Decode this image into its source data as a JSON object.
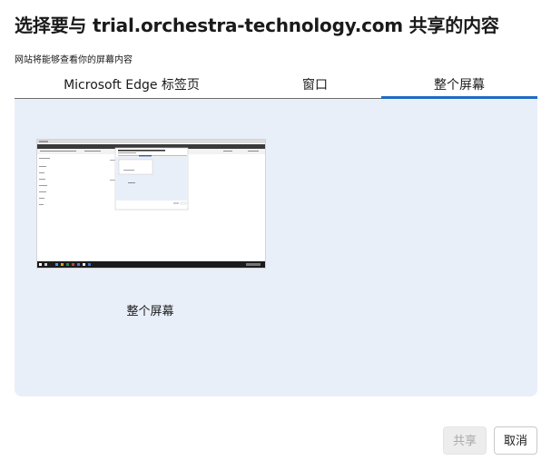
{
  "dialog": {
    "title": "选择要与 trial.orchestra-technology.com 共享的内容",
    "subtitle": "网站将能够查看你的屏幕内容"
  },
  "tabs": [
    {
      "label": "Microsoft Edge 标签页",
      "active": false
    },
    {
      "label": "窗口",
      "active": false
    },
    {
      "label": "整个屏幕",
      "active": true
    }
  ],
  "screens": [
    {
      "label": "整个屏幕",
      "selected": false
    }
  ],
  "buttons": {
    "share_label": "共享",
    "share_enabled": false,
    "cancel_label": "取消"
  },
  "colors": {
    "accent": "#1f6bc4",
    "panel_background": "#e9eff9",
    "disabled_text": "#a8a8a8"
  }
}
